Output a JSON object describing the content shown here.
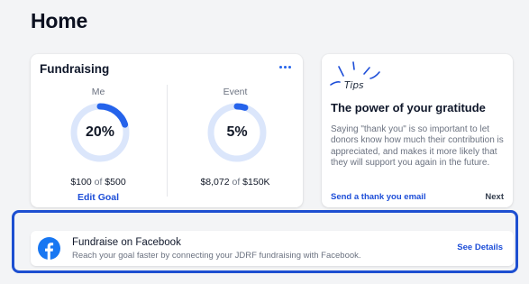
{
  "page": {
    "title": "Home"
  },
  "fundraising": {
    "title": "Fundraising",
    "more_icon": "ellipsis-icon",
    "me": {
      "label": "Me",
      "percent_text": "20%",
      "progress": 0.2,
      "raised": "$100",
      "of": "of",
      "goal": "$500",
      "edit_goal": "Edit Goal"
    },
    "event": {
      "label": "Event",
      "percent_text": "5%",
      "progress": 0.05,
      "raised": "$8,072",
      "of": "of",
      "goal": "$150K"
    }
  },
  "tips": {
    "badge": "Tips",
    "heading": "The power of your gratitude",
    "body": "Saying \"thank you\" is so important to let donors know how much their contribution is appreciated, and makes it more likely that they will support you again in the future.",
    "link": "Send a thank you email",
    "next": "Next"
  },
  "facebook": {
    "title": "Fundraise on Facebook",
    "description": "Reach your goal faster by connecting your JDRF fundraising with Facebook.",
    "details": "See Details",
    "icon": "facebook-icon"
  },
  "colors": {
    "accent": "#1d4ed8",
    "ring_track": "#dbe6fb",
    "ring_fill": "#2563eb",
    "highlight_border": "#1d4fd1",
    "facebook_blue": "#1877f2"
  }
}
